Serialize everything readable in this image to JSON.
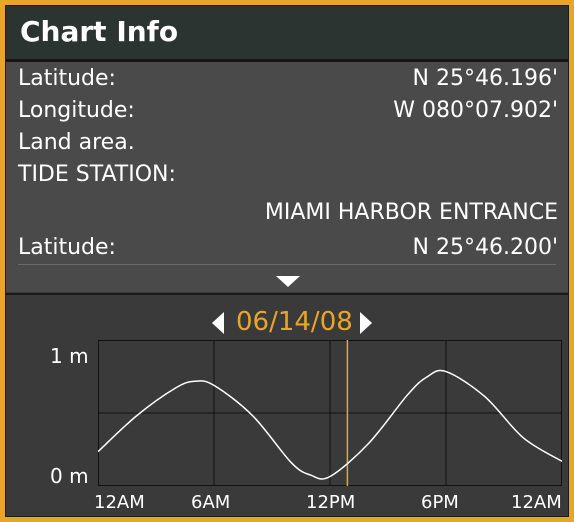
{
  "window": {
    "title": "Chart Info"
  },
  "info": {
    "rows": [
      {
        "label": "Latitude:",
        "value": "N 25°46.196'"
      },
      {
        "label": "Longitude:",
        "value": "W 080°07.902'"
      },
      {
        "label": "Land area.",
        "value": ""
      },
      {
        "label": "TIDE STATION:",
        "value": ""
      },
      {
        "label": "",
        "value": "MIAMI HARBOR ENTRANCE"
      },
      {
        "label": "Latitude:",
        "value": "N 25°46.200'"
      }
    ]
  },
  "tide": {
    "date": "06/14/08",
    "y_labels": {
      "top": "1 m",
      "bottom": "0 m"
    },
    "x_labels": [
      "12AM",
      "6AM",
      "12PM",
      "6PM",
      "12AM"
    ],
    "colors": {
      "curve": "#ffffff",
      "current_time": "#e8a628",
      "grid": "#111111"
    }
  },
  "chart_data": {
    "type": "line",
    "title": "",
    "xlabel": "",
    "ylabel": "",
    "x_ticks": [
      "12AM",
      "6AM",
      "12PM",
      "6PM",
      "12AM"
    ],
    "ylim": [
      0,
      1
    ],
    "y_ticks": [
      "0 m",
      "1 m"
    ],
    "grid": true,
    "current_time_hours": 12.9,
    "series": [
      {
        "x_hours": [
          0,
          2,
          4,
          5,
          6,
          8,
          10,
          11,
          12,
          14,
          16,
          17,
          18,
          20,
          22,
          24
        ],
        "values": [
          0.22,
          0.48,
          0.68,
          0.73,
          0.7,
          0.48,
          0.14,
          0.05,
          0.04,
          0.28,
          0.63,
          0.76,
          0.8,
          0.62,
          0.32,
          0.15
        ]
      }
    ]
  }
}
